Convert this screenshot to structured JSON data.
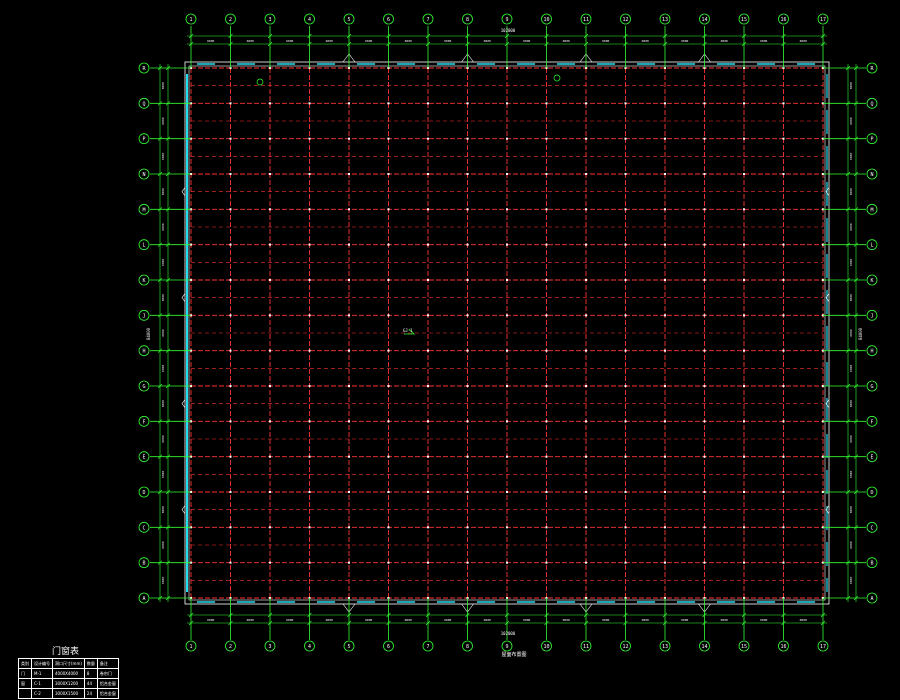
{
  "drawing": {
    "background_color": "#000000",
    "axis_color": "#33ff33",
    "grid_color": "#ff3333",
    "wall_color": "#22ddee",
    "text_color": "#ffffff",
    "overall_dimension_top": "102000",
    "overall_dimension_bottom": "102000",
    "overall_dimension_left": "84000",
    "overall_dimension_right": "84000",
    "drawing_title": "屋面布置图",
    "center_label": "GJ-1"
  },
  "axes": {
    "columns": [
      "1",
      "2",
      "3",
      "4",
      "5",
      "6",
      "7",
      "8",
      "9",
      "10",
      "11",
      "12",
      "13",
      "14",
      "15",
      "16",
      "17"
    ],
    "rows": [
      "A",
      "B",
      "C",
      "D",
      "E",
      "F",
      "G",
      "H",
      "J",
      "K",
      "L",
      "M",
      "N",
      "P",
      "Q",
      "R"
    ]
  },
  "dimensions": {
    "column_spacing": [
      "6000",
      "6000",
      "6000",
      "6000",
      "6000",
      "6000",
      "6000",
      "6000",
      "6000",
      "6000",
      "6000",
      "6000",
      "6000",
      "6000",
      "6000",
      "6000"
    ],
    "row_spacing": [
      "6000",
      "6000",
      "6000",
      "6000",
      "6000",
      "6000",
      "6000",
      "6000",
      "6000",
      "6000",
      "6000",
      "6000",
      "6000",
      "6000",
      "6000"
    ]
  },
  "legend": {
    "title": "门窗表",
    "headers": [
      "类别",
      "设计编号",
      "洞口尺寸(mm)",
      "数量",
      "备注"
    ],
    "rows": [
      [
        "门",
        "M-1",
        "4000X4000",
        "8",
        "卷帘门"
      ],
      [
        "窗",
        "C-1",
        "3000X1200",
        "44",
        "铝合金窗"
      ],
      [
        "",
        "C-2",
        "3000X1500",
        "24",
        "铝合金窗"
      ]
    ]
  }
}
